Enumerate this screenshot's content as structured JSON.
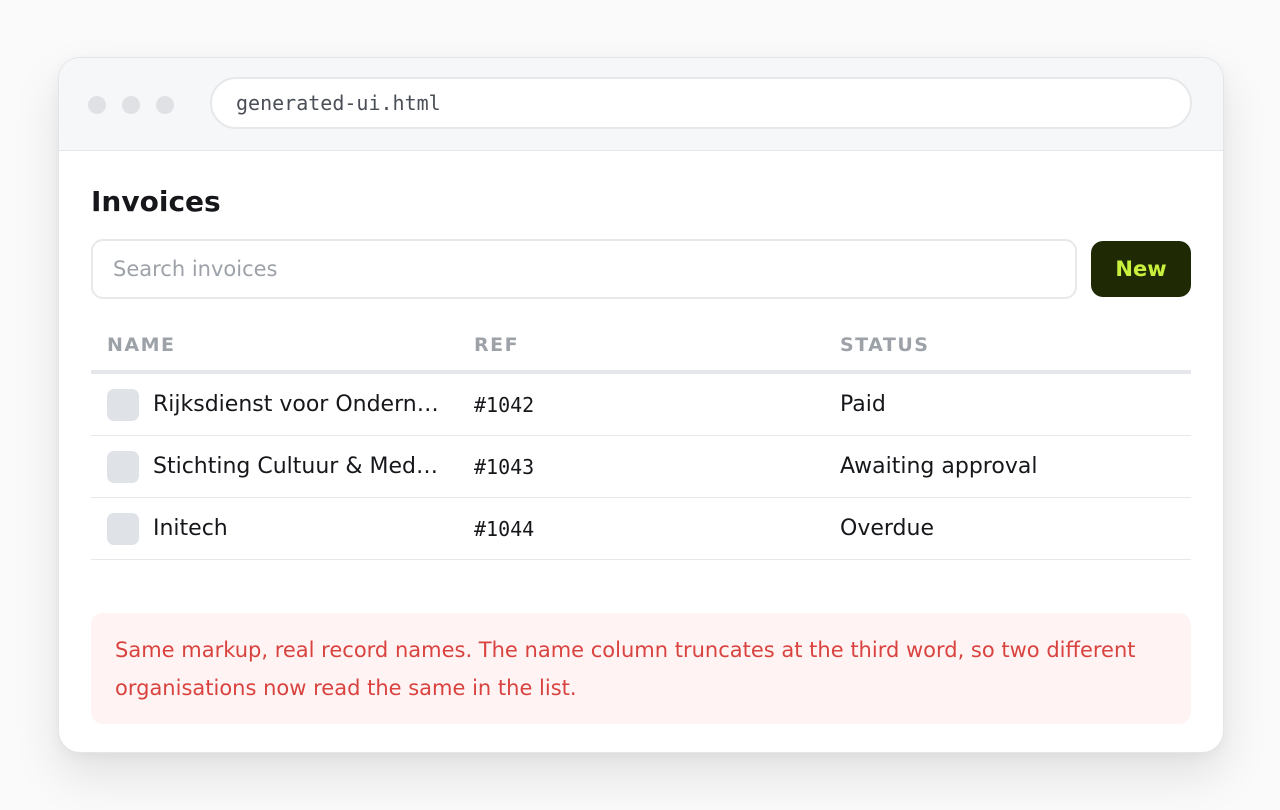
{
  "browser": {
    "address": "generated-ui.html"
  },
  "page": {
    "title": "Invoices"
  },
  "search": {
    "placeholder": "Search invoices",
    "value": ""
  },
  "toolbar": {
    "new_label": "New"
  },
  "table": {
    "headers": {
      "name": "NAME",
      "ref": "REF",
      "status": "STATUS"
    },
    "rows": [
      {
        "name": "Rijksdienst voor Ondernemend Nederland",
        "ref": "#1042",
        "status": "Paid"
      },
      {
        "name": "Stichting Cultuur & Media Amsterdam",
        "ref": "#1043",
        "status": "Awaiting approval"
      },
      {
        "name": "Initech",
        "ref": "#1044",
        "status": "Overdue"
      }
    ]
  },
  "notice": {
    "text": "Same markup, real record names. The name column truncates at the third word, so two different organisations now read the same in the list."
  },
  "colors": {
    "accent_bg": "#1f2a05",
    "accent_fg": "#c8f03c",
    "notice_bg": "#fff3f3",
    "notice_fg": "#d9433f"
  }
}
